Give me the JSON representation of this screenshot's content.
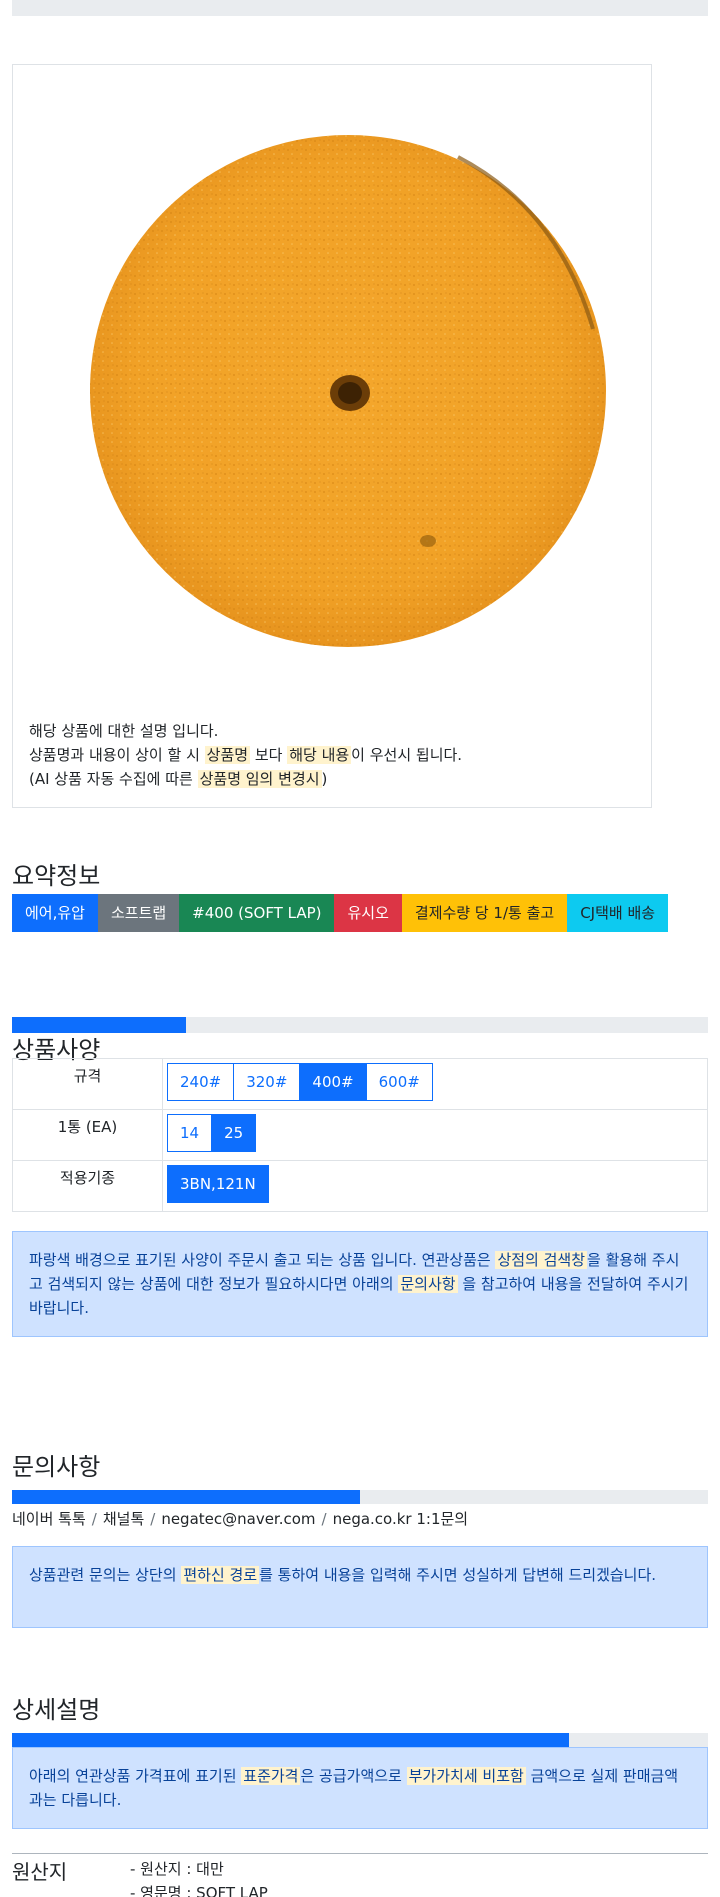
{
  "product": {
    "image_alt": "SOFT LAP disc",
    "desc_line1": "해당 상품에 대한 설명 입니다.",
    "desc_line2_a": "상품명과 내용이 상이 할 시 ",
    "desc_line2_h1": "상품명",
    "desc_line2_b": " 보다 ",
    "desc_line2_h2": "해당 내용",
    "desc_line2_c": "이 우선시 됩니다.",
    "desc_line3_a": "(AI 상품 자동 수집에 따른 ",
    "desc_line3_h": "상품명 임의 변경시",
    "desc_line3_b": ")"
  },
  "summary": {
    "title": "요약정보",
    "badges": [
      "에어,유압",
      "소프트랩",
      "#400 (SOFT LAP)",
      "유시오",
      "결제수량 당 1/통 출고",
      "CJ택배 배송"
    ]
  },
  "spec": {
    "title": "상품사양",
    "progress": 0.25,
    "rows": [
      {
        "label": "규격",
        "options": [
          "240#",
          "320#",
          "400#",
          "600#"
        ],
        "selected": "400#"
      },
      {
        "label": "1통 (EA)",
        "options": [
          "14",
          "25"
        ],
        "selected": "25"
      },
      {
        "label": "적용기종",
        "options": [
          "3BN,121N"
        ],
        "selected": "3BN,121N"
      }
    ],
    "notice_a": "파랑색 배경으로 표기된 사양이 주문시 출고 되는 상품 입니다. 연관상품은 ",
    "notice_h1": "상점의 검색창",
    "notice_b": "을 활용해 주시고 검색되지 않는 상품에 대한 정보가 필요하시다면 아래의 ",
    "notice_h2": "문의사항",
    "notice_c": " 을 참고하여 내용을 전달하여 주시기 바랍니다."
  },
  "inquiry": {
    "title": "문의사항",
    "progress": 0.5,
    "channels": [
      "네이버 톡톡",
      "채널톡",
      "negatec@naver.com",
      "nega.co.kr 1:1문의"
    ],
    "notice_a": "상품관련 문의는 상단의 ",
    "notice_h": "편하신 경로",
    "notice_b": "를 통하여 내용을 입력해 주시면 성실하게 답변해 드리겠습니다."
  },
  "detail": {
    "title": "상세설명",
    "progress": 0.8,
    "notice_a": "아래의 연관상품 가격표에 표기된 ",
    "notice_h1": "표준가격",
    "notice_b": "은 공급가액으로 ",
    "notice_h2": "부가가치세 비포함",
    "notice_c": " 금액으로 실제 판매금액과는 다릅니다."
  },
  "origin": {
    "title": "원산지",
    "items": [
      "- 원산지 : 대만",
      "- 영문명 : SOFT LAP"
    ]
  }
}
